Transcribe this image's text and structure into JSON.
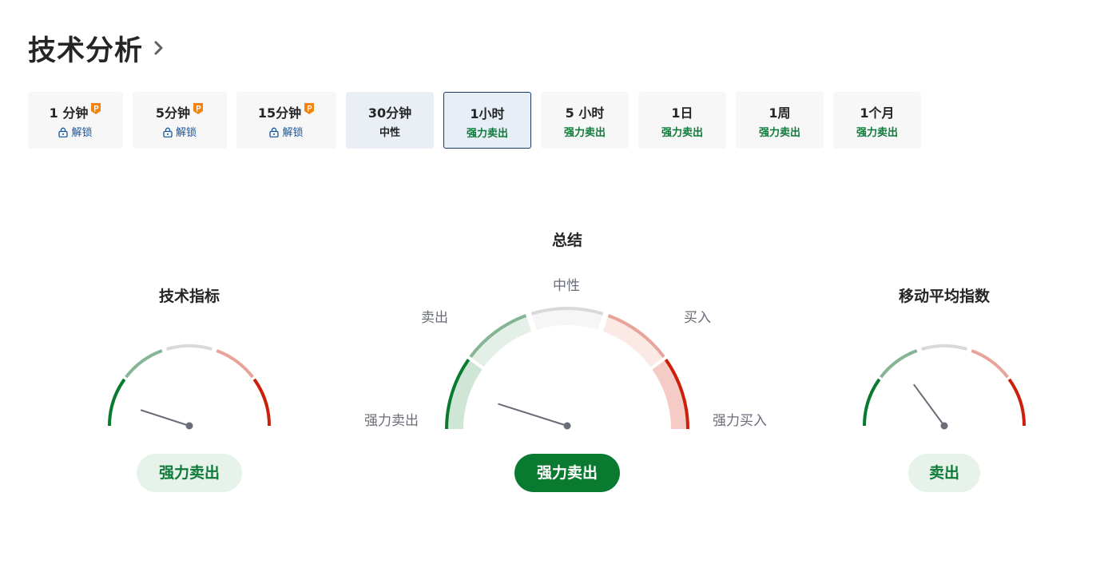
{
  "header": {
    "title": "技术分析"
  },
  "tabs": [
    {
      "label": "1 分钟",
      "status": "解锁",
      "locked": true
    },
    {
      "label": "5分钟",
      "status": "解锁",
      "locked": true
    },
    {
      "label": "15分钟",
      "status": "解锁",
      "locked": true
    },
    {
      "label": "30分钟",
      "status": "中性",
      "locked": false
    },
    {
      "label": "1小时",
      "status": "强力卖出",
      "locked": false,
      "active": true
    },
    {
      "label": "5 小时",
      "status": "强力卖出",
      "locked": false
    },
    {
      "label": "1日",
      "status": "强力卖出",
      "locked": false
    },
    {
      "label": "1周",
      "status": "强力卖出",
      "locked": false
    },
    {
      "label": "1个月",
      "status": "强力卖出",
      "locked": false
    }
  ],
  "gauges": {
    "indicators": {
      "title": "技术指标",
      "result": "强力卖出"
    },
    "summary": {
      "title": "总结",
      "result": "强力卖出",
      "zone_labels": {
        "strong_sell": "强力卖出",
        "sell": "卖出",
        "neutral": "中性",
        "buy": "买入",
        "strong_buy": "强力买入"
      }
    },
    "moving_averages": {
      "title": "移动平均指数",
      "result": "卖出"
    }
  },
  "colors": {
    "strong_sell": "#0a7a31",
    "sell": "#86b596",
    "neutral": "#d9d9db",
    "buy": "#e8a39b",
    "strong_buy": "#cc1f0c",
    "needle": "#6a6d78"
  }
}
